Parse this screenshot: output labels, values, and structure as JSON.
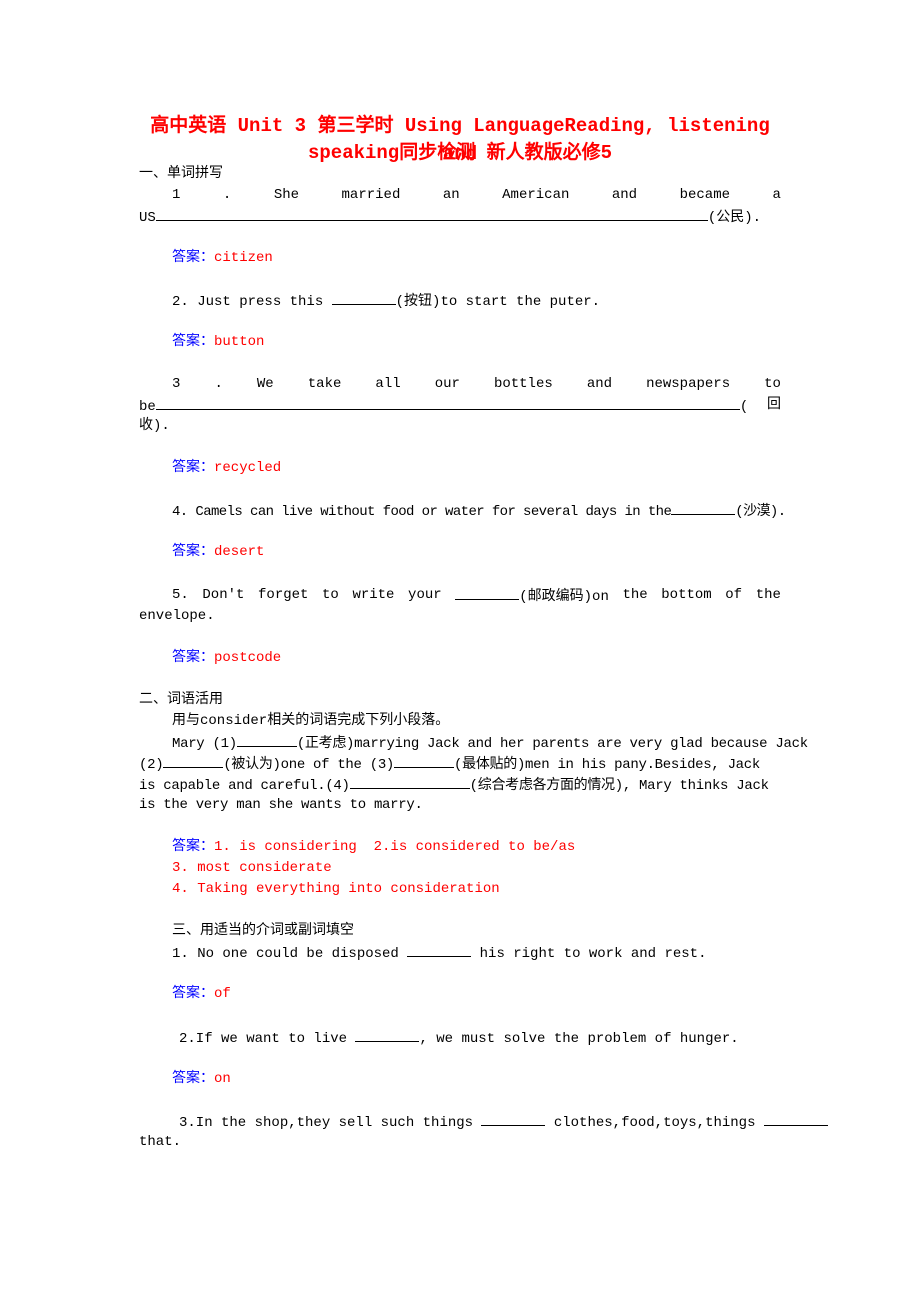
{
  "title": {
    "line1": "高中英语 Unit 3 第三学时 Using LanguageReading, listening and",
    "line2": "speaking同步检测 新人教版必修5"
  },
  "answer_label": "答案：",
  "colors": {
    "title": "#ff0000",
    "answer_label": "#0000ff",
    "answer_text": "#ff0000"
  },
  "section1": {
    "heading": "一、单词拼写",
    "q1": {
      "words": [
        "1",
        ".",
        "She",
        "married",
        "an",
        "American",
        "and",
        "became",
        "a"
      ],
      "line2_start": "US",
      "line2_end": "(公民).",
      "answer": "citizen"
    },
    "q2": {
      "before": "2. Just press this ",
      "hint": "(按钮)to start the puter.",
      "answer": "button"
    },
    "q3": {
      "words": [
        "3",
        ".",
        "We",
        "take",
        "all",
        "our",
        "bottles",
        "and",
        "newspapers",
        "to"
      ],
      "line2_start": "be",
      "line2_end_a": "(",
      "line2_end_b": "回",
      "line3": "收).",
      "answer": "recycled"
    },
    "q4": {
      "before": "4. Camels can live without food or water for several days in the",
      "hint": "(沙漠).",
      "answer": "desert"
    },
    "q5": {
      "words_before": [
        "5.",
        "Don't",
        "forget",
        "to",
        "write",
        "your"
      ],
      "hint": "(邮政编码)on",
      "words_after": [
        "the",
        "bottom",
        "of",
        "the"
      ],
      "line2": "envelope.",
      "answer": "postcode"
    }
  },
  "section2": {
    "heading": "二、词语活用",
    "instruction": "用与consider相关的词语完成下列小段落。",
    "p1a": "Mary (1)",
    "p1b": "(正考虑)marrying Jack and her parents are very glad because Jack",
    "p2a": "(2)",
    "p2b": "(被认为)one of the (3)",
    "p2c": "(最体贴的)men in his pany.Besides, Jack",
    "p3a": "is capable and careful.(4)",
    "p3b": "(综合考虑各方面的情况), Mary thinks Jack",
    "p4": "is the very man she wants to marry.",
    "answers": [
      "1. is considering  2.is considered to be/as",
      "3. most considerate",
      "4. Taking everything into consideration"
    ]
  },
  "section3": {
    "heading": "三、用适当的介词或副词填空",
    "q1": {
      "before": "1. No one could be disposed ",
      "after": " his right to work and rest.",
      "answer": "of"
    },
    "q2": {
      "before": "2.If we want to live ",
      "after": ", we must solve the problem of hunger.",
      "answer": "on"
    },
    "q3": {
      "before": "3.In the shop,they sell such things ",
      "middle": " clothes,food,toys,things ",
      "line2": "that."
    }
  }
}
